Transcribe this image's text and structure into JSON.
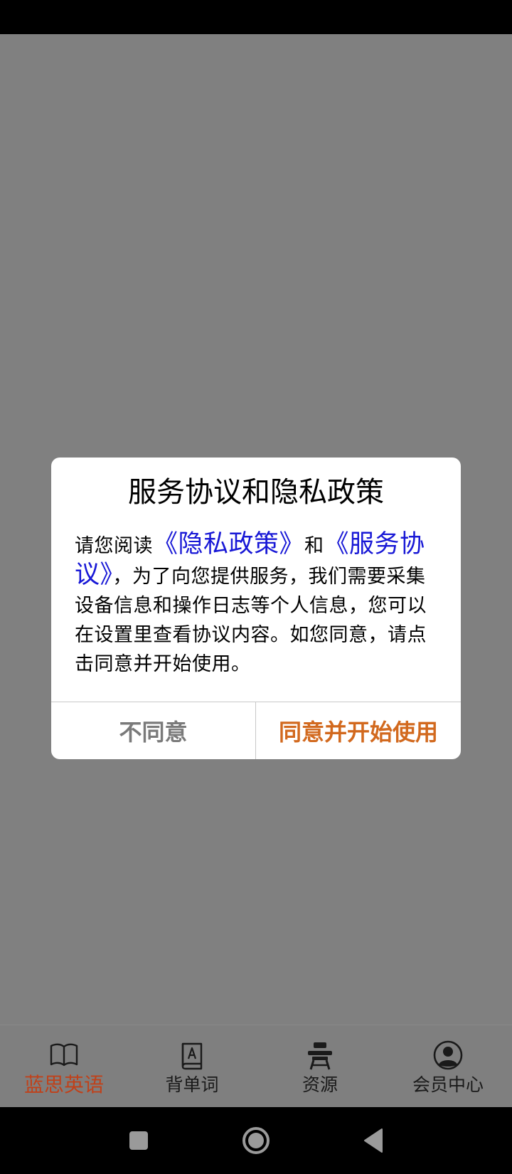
{
  "dialog": {
    "title": "服务协议和隐私政策",
    "body_intro": "请您阅读",
    "privacy_link": "《隐私政策》",
    "and": "和",
    "service_link": "《服务协议》",
    "body_rest": "，为了向您提供服务，我们需要采集设备信息和操作日志等个人信息，您可以在设置里查看协议内容。如您同意，请点击同意并开始使用。",
    "disagree_label": "不同意",
    "agree_label": "同意并开始使用"
  },
  "tabs": [
    {
      "label": "蓝思英语",
      "icon": "open-book-icon",
      "active": true
    },
    {
      "label": "背单词",
      "icon": "vocabulary-book-icon",
      "active": false
    },
    {
      "label": "资源",
      "icon": "desk-chair-icon",
      "active": false
    },
    {
      "label": "会员中心",
      "icon": "user-circle-icon",
      "active": false
    }
  ],
  "navigation": {
    "recents": "square-recents-icon",
    "home": "circle-home-icon",
    "back": "triangle-back-icon"
  },
  "colors": {
    "overlay": "#808080",
    "link": "#1818d6",
    "accent": "#d2691e",
    "active_tab": "#c0411a",
    "disagree": "#7a7a7a"
  }
}
